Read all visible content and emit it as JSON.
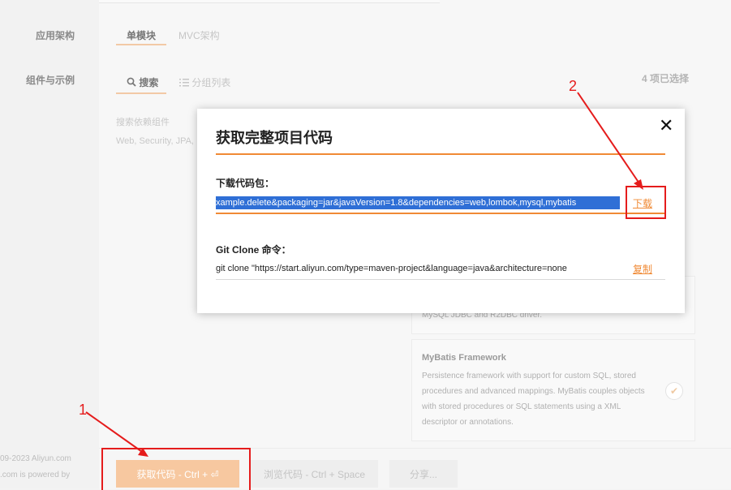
{
  "sidebar": {
    "app_arch_label": "应用架构",
    "components_label": "组件与示例"
  },
  "arch_tabs": [
    {
      "label": "单模块",
      "active": true
    },
    {
      "label": "MVC架构",
      "active": false
    }
  ],
  "component_tabs": [
    {
      "label": "搜索",
      "icon": "search-icon",
      "active": true
    },
    {
      "label": "分组列表",
      "icon": "list-icon",
      "active": false
    }
  ],
  "selected_count": "4 项已选择",
  "search": {
    "placeholder": "搜索依赖组件",
    "hint": "Web, Security, JPA,"
  },
  "cards": [
    {
      "title": "",
      "desc": "MySQL JDBC and R2DBC driver."
    },
    {
      "title": "MyBatis Framework",
      "desc": "Persistence framework with support for custom SQL, stored procedures and advanced mappings. MyBatis couples objects with stored procedures or SQL statements using a XML descriptor or annotations."
    }
  ],
  "footer": {
    "line1": "09-2023 Aliyun.com",
    "line2": ".com is powered by"
  },
  "actions": {
    "get_code": "获取代码 - Ctrl + ⏎",
    "browse_code": "浏览代码 - Ctrl + Space",
    "share": "分享..."
  },
  "dialog": {
    "title": "获取完整项目代码",
    "download_label": "下载代码包：",
    "download_url": "xample.delete&packaging=jar&javaVersion=1.8&dependencies=web,lombok,mysql,mybatis",
    "download_link": "下载",
    "git_label": "Git Clone 命令：",
    "git_command": "git clone \"https://start.aliyun.com/type=maven-project&language=java&architecture=none",
    "copy_link": "复制",
    "close_icon": "close-icon"
  },
  "annotations": {
    "label1": "1",
    "label2": "2",
    "color": "#e51c1c"
  },
  "colors": {
    "accent": "#f08a35",
    "primary_button": "#f7c8a0",
    "selection": "#2f6fd6"
  }
}
